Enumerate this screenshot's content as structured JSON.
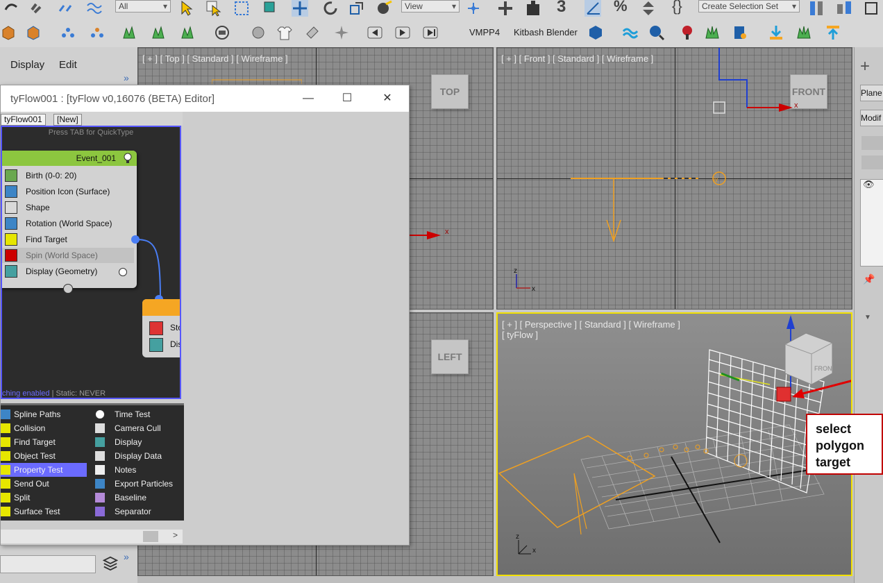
{
  "toolbar": {
    "filter_dropdown": "All",
    "view_dropdown": "View",
    "selection_set_dropdown": "Create Selection Set",
    "vmpp4_label": "VMPP4",
    "kitbash_label": "Kitbash Blender"
  },
  "menu": {
    "display": "Display",
    "edit": "Edit"
  },
  "viewports": {
    "top": {
      "label": "[ + ] [ Top ] [ Standard ] [ Wireframe ]",
      "cube": "TOP"
    },
    "front": {
      "label": "[ + ] [ Front ] [ Standard ] [ Wireframe ]",
      "cube": "FRONT"
    },
    "left": {
      "cube": "LEFT"
    },
    "perspective": {
      "label": "[ + ] [ Perspective ] [ Standard ] [ Wireframe ]",
      "sublabel": "[ tyFlow ]"
    }
  },
  "right_panel": {
    "plane_label": "Plane",
    "modifier_label": "Modif"
  },
  "editor": {
    "title": "tyFlow001 : [tyFlow v0,16076 (BETA) Editor]",
    "tabs": [
      "tyFlow001",
      "[New]"
    ],
    "quicktype_hint": "Press TAB for QuickType",
    "event": {
      "title": "Event_001",
      "operators": [
        {
          "label": "Birth (0-0: 20)",
          "icon": "birth-icon",
          "color": "#6aa84f"
        },
        {
          "label": "Position Icon (Surface)",
          "icon": "position-icon",
          "color": "#3d85c6"
        },
        {
          "label": "Shape",
          "icon": "shape-icon",
          "color": "#d9d9d9"
        },
        {
          "label": "Rotation (World Space)",
          "icon": "rotation-icon",
          "color": "#3d85c6"
        },
        {
          "label": "Find Target",
          "icon": "find-target-icon",
          "color": "#e6e600"
        },
        {
          "label": "Spin (World Space)",
          "icon": "spin-icon",
          "color": "#cc0000"
        },
        {
          "label": "Display (Geometry)",
          "icon": "display-icon",
          "color": "#45a0a0"
        }
      ]
    },
    "stop_event": {
      "operators": [
        "Sto",
        "Dis"
      ]
    },
    "status_enabled": "ching enabled",
    "status_static": " | Static: NEVER",
    "palette_left": [
      "Spline Paths",
      "Collision",
      "Find Target",
      "Object Test",
      "Property Test",
      "Send Out",
      "Split",
      "Surface Test"
    ],
    "palette_right": [
      "Time Test",
      "Camera Cull",
      "Display",
      "Display Data",
      "Notes",
      "Export Particles",
      "Baseline",
      "Separator"
    ],
    "palette_selected": "Property Test"
  },
  "callout": {
    "lines": [
      "select",
      "polygon",
      "target"
    ]
  },
  "colors": {
    "accent_selection": "#6b6bff",
    "event_header": "#8cc63f",
    "stop_header": "#f5a623",
    "perspective_border": "#f2e000",
    "callout_red": "#c00000",
    "wire_orange": "#f0a020"
  }
}
